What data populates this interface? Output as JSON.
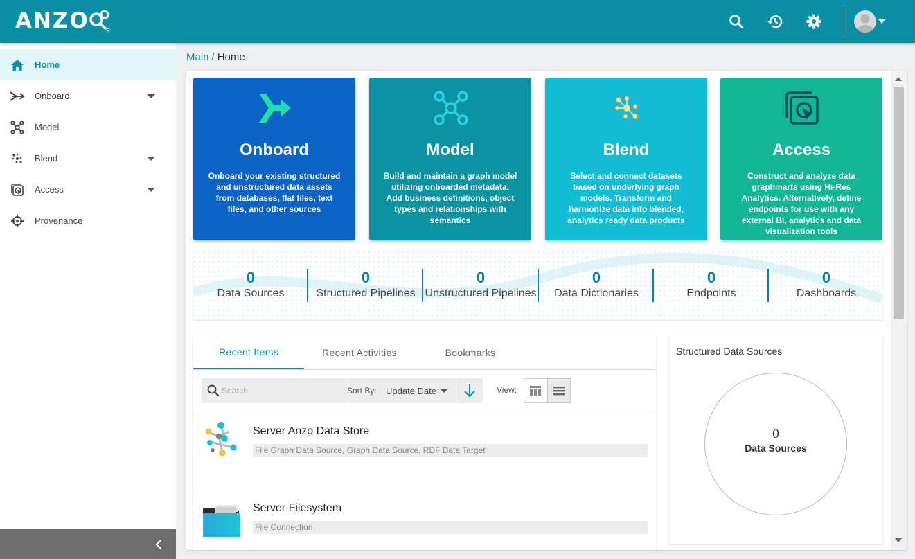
{
  "app": {
    "logo_text": "ANZO",
    "accent_color": "#0a8fa5"
  },
  "header": {
    "icons": [
      "search-icon",
      "history-icon",
      "settings-icon",
      "user-avatar",
      "chevron-down-icon"
    ]
  },
  "sidebar": {
    "items": [
      {
        "label": "Home",
        "icon": "home-icon",
        "active": true,
        "has_caret": false
      },
      {
        "label": "Onboard",
        "icon": "onboard-icon",
        "active": false,
        "has_caret": true
      },
      {
        "label": "Model",
        "icon": "model-icon",
        "active": false,
        "has_caret": false
      },
      {
        "label": "Blend",
        "icon": "blend-icon",
        "active": false,
        "has_caret": true
      },
      {
        "label": "Access",
        "icon": "access-icon",
        "active": false,
        "has_caret": true
      },
      {
        "label": "Provenance",
        "icon": "provenance-icon",
        "active": false,
        "has_caret": false
      }
    ]
  },
  "breadcrumb": {
    "root": "Main",
    "separator": "/",
    "current": "Home"
  },
  "cards": [
    {
      "title": "Onboard",
      "description": "Onboard your existing structured and unstructured data assets from databases, flat files, text files, and other sources",
      "color": "#0b63c5"
    },
    {
      "title": "Model",
      "description": "Build and maintain a graph model utilizing onboarded metadata. Add business definitions, object types and relationships with semantics",
      "color": "#0b93a4"
    },
    {
      "title": "Blend",
      "description": "Select and connect datasets based on underlying graph models. Transform and harmonize data into blended, analytics ready data products",
      "color": "#11bcd4"
    },
    {
      "title": "Access",
      "description": "Construct and analyze data graphmarts using Hi-Res Analytics. Alternatively, define endpoints for use with any external BI, analytics and data visualization tools",
      "color": "#14b596"
    }
  ],
  "stats": [
    {
      "value": "0",
      "label": "Data Sources"
    },
    {
      "value": "0",
      "label": "Structured Pipelines"
    },
    {
      "value": "0",
      "label": "Unstructured Pipelines"
    },
    {
      "value": "0",
      "label": "Data Dictionaries"
    },
    {
      "value": "0",
      "label": "Endpoints"
    },
    {
      "value": "0",
      "label": "Dashboards"
    }
  ],
  "recent": {
    "tabs": [
      "Recent Items",
      "Recent Activities",
      "Bookmarks"
    ],
    "active_tab": 0,
    "search_placeholder": "Search",
    "sort_label": "Sort By:",
    "sort_value": "Update Date",
    "view_label": "View:",
    "items": [
      {
        "title": "Server Anzo Data Store",
        "tags": "File Graph Data Source, Graph Data Source, RDF Data Target"
      },
      {
        "title": "Server Filesystem",
        "tags": "File Connection"
      }
    ]
  },
  "structured_sources": {
    "title": "Structured Data Sources",
    "value": "0",
    "label": "Data Sources"
  }
}
